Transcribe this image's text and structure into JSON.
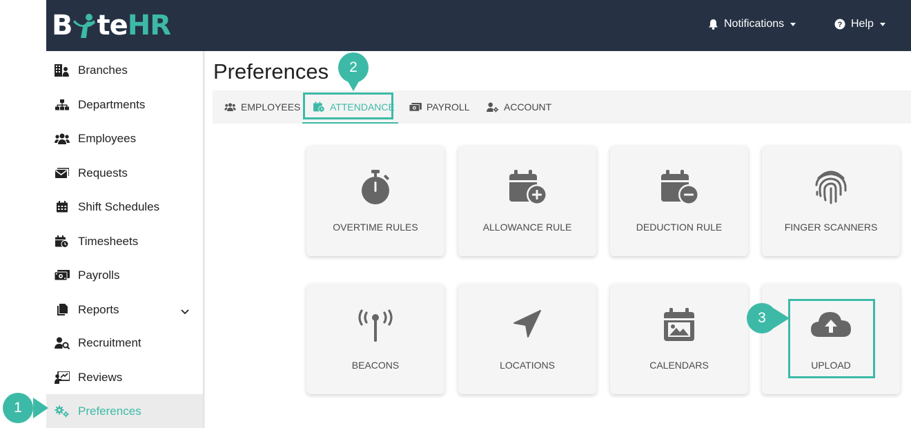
{
  "brand": {
    "logo_text_left": "B",
    "logo_text_mid": "te",
    "logo_text_right": "HR"
  },
  "topnav": {
    "notifications": "Notifications",
    "help": "Help"
  },
  "sidebar": {
    "items": [
      {
        "label": "Branches"
      },
      {
        "label": "Departments"
      },
      {
        "label": "Employees"
      },
      {
        "label": "Requests"
      },
      {
        "label": "Shift Schedules"
      },
      {
        "label": "Timesheets"
      },
      {
        "label": "Payrolls"
      },
      {
        "label": "Reports"
      },
      {
        "label": "Recruitment"
      },
      {
        "label": "Reviews"
      },
      {
        "label": "Preferences"
      }
    ],
    "active": "Preferences"
  },
  "main": {
    "title": "Preferences",
    "tabs": [
      {
        "label": "EMPLOYEES"
      },
      {
        "label": "ATTENDANCE"
      },
      {
        "label": "PAYROLL"
      },
      {
        "label": "ACCOUNT"
      }
    ],
    "active_tab": "ATTENDANCE",
    "cards": [
      {
        "label": "OVERTIME RULES",
        "icon": "stopwatch-icon"
      },
      {
        "label": "ALLOWANCE RULE",
        "icon": "calendar-plus-icon"
      },
      {
        "label": "DEDUCTION RULE",
        "icon": "calendar-minus-icon"
      },
      {
        "label": "FINGER SCANNERS",
        "icon": "fingerprint-icon"
      },
      {
        "label": "BEACONS",
        "icon": "broadcast-tower-icon"
      },
      {
        "label": "LOCATIONS",
        "icon": "location-arrow-icon"
      },
      {
        "label": "CALENDARS",
        "icon": "calendar-image-icon"
      },
      {
        "label": "UPLOAD",
        "icon": "cloud-upload-icon"
      }
    ]
  },
  "annotations": {
    "step1": "1",
    "step2": "2",
    "step3": "3"
  },
  "colors": {
    "accent": "#3dbaa7",
    "topbar": "#263244",
    "icon": "#666666"
  }
}
